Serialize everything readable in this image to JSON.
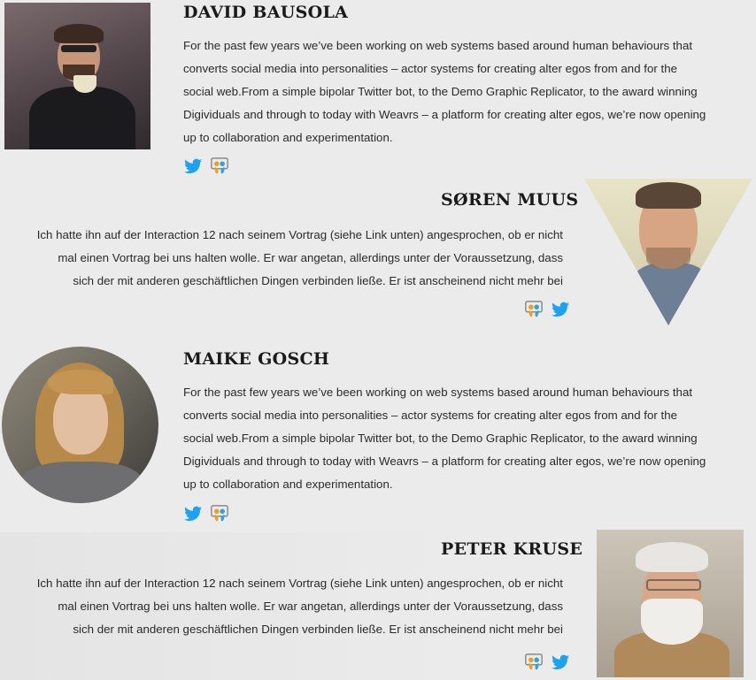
{
  "speakers": [
    {
      "name": "DAVID BAUSOLA",
      "bio": [
        "For the past few years we’ve been working on web systems based around human behaviours that",
        "converts social media into personalities – actor systems for creating alter egos from and for the",
        "social web.From a simple bipolar Twitter bot, to the Demo Graphic Replicator, to the award winning",
        "Digividuals and through to today with Weavrs – a platform for creating alter egos, we’re now opening",
        "up to collaboration and experimentation."
      ],
      "icons": [
        "twitter-icon",
        "slideshare-icon"
      ]
    },
    {
      "name": "SØREN MUUS",
      "bio": [
        "Ich hatte ihn auf der Interaction 12 nach seinem Vortrag (siehe Link unten) angesprochen, ob er nicht",
        "mal einen Vortrag bei uns halten wolle. Er war angetan, allerdings unter der Voraussetzung, dass",
        "sich der mit anderen geschäftlichen Dingen verbinden ließe. Er ist anscheinend nicht mehr bei"
      ],
      "icons": [
        "slideshare-icon",
        "twitter-icon"
      ]
    },
    {
      "name": "MAIKE GOSCH",
      "bio": [
        "For the past few years we’ve been working on web systems based around human behaviours that",
        "converts social media into personalities – actor systems for creating alter egos from and for the",
        "social web.From a simple bipolar Twitter bot, to the Demo Graphic Replicator, to the award winning",
        "Digividuals and through to today with Weavrs – a platform for creating alter egos, we’re now opening",
        "up to collaboration and experimentation."
      ],
      "icons": [
        "twitter-icon",
        "slideshare-icon"
      ]
    },
    {
      "name": "PETER KRUSE",
      "bio": [
        "Ich hatte ihn auf der Interaction 12 nach seinem Vortrag (siehe Link unten) angesprochen, ob er nicht",
        "mal einen Vortrag bei uns halten wolle. Er war angetan, allerdings unter der Voraussetzung, dass",
        "sich der mit anderen geschäftlichen Dingen verbinden ließe. Er ist anscheinend nicht mehr bei"
      ],
      "icons": [
        "slideshare-icon",
        "twitter-icon"
      ]
    }
  ],
  "colors": {
    "background": "#ebebeb",
    "twitter": "#1da1f2",
    "slideshare_orange": "#f39c1f",
    "slideshare_blue": "#2aa6d6",
    "text": "#2a2a2a"
  }
}
